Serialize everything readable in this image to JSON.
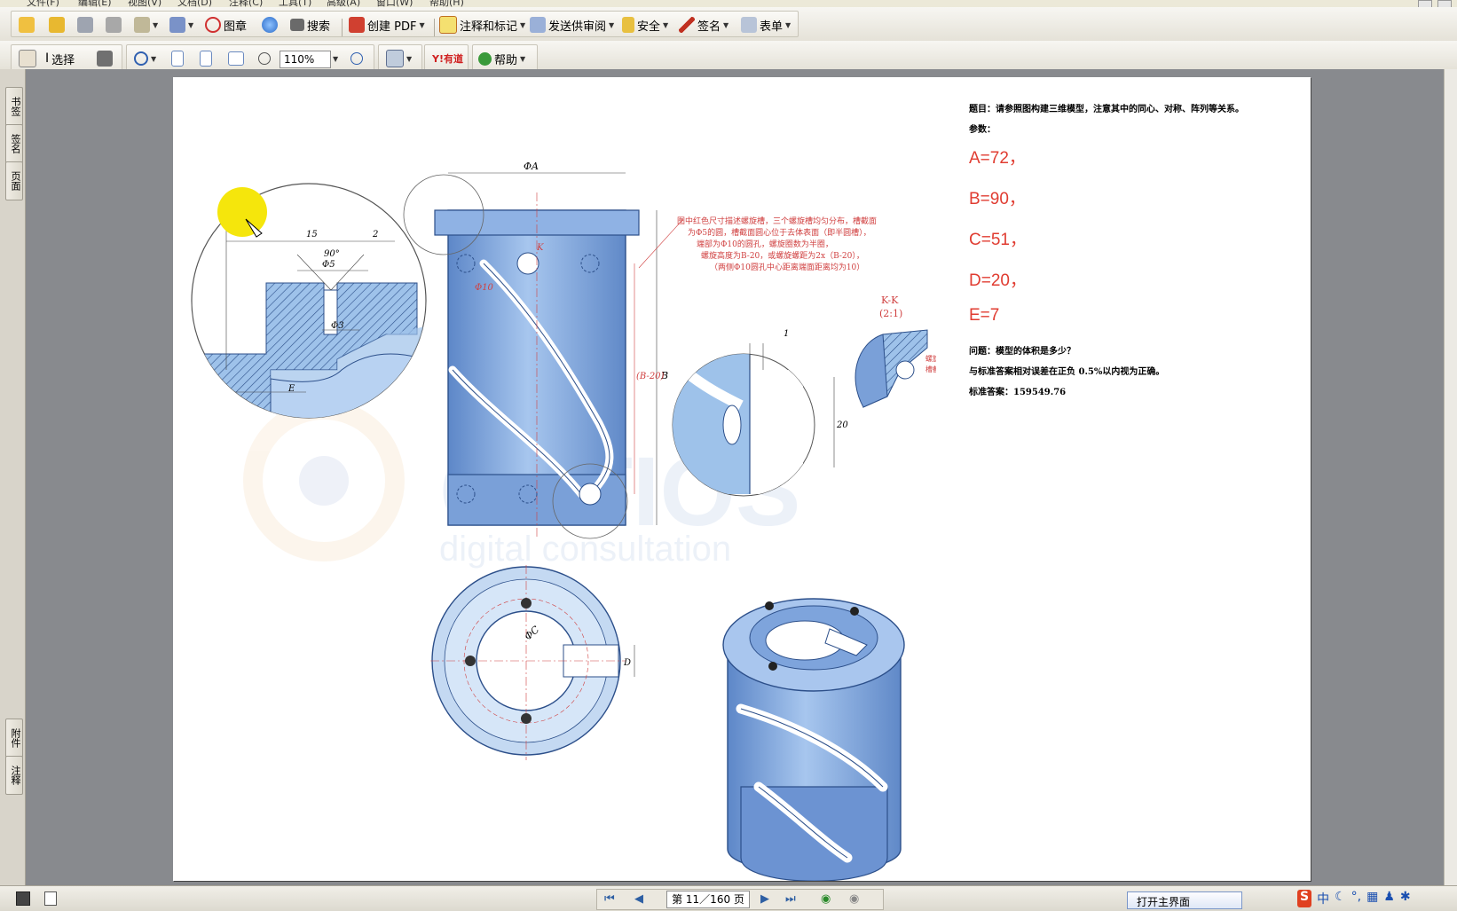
{
  "menubar": {
    "items": [
      "文件(F)",
      "编辑(E)",
      "视图(V)",
      "文档(D)",
      "注释(C)",
      "工具(T)",
      "高级(A)",
      "窗口(W)",
      "帮助(H)"
    ]
  },
  "toolbar1": {
    "stamp_label": "图章",
    "search_label": "搜索",
    "create_pdf_label": "创建 PDF",
    "comment_label": "注释和标记",
    "send_review_label": "发送供审阅",
    "security_label": "安全",
    "sign_label": "签名",
    "forms_label": "表单"
  },
  "toolbar2": {
    "select_label": "选择",
    "zoom_value": "110%",
    "help_label": "帮助",
    "yd_label": "Y!有道"
  },
  "left_tabs": {
    "bookmarks": "书签",
    "signatures": "签名",
    "pages": "页面",
    "attachments": "附件",
    "comments": "注释"
  },
  "page": {
    "question_title": "题目：请参照图构建三维模型，注意其中的同心、对称、阵列等关系。",
    "params_label": "参数：",
    "params": [
      "A=72，",
      "B=90，",
      "C=51，",
      "D=20，",
      "E=7"
    ],
    "question": "问题：模型的体积是多少？",
    "tolerance_note": "与标准答案相对误差在正负 0.5%以内视为正确。",
    "answer": "标准答案：159549.76",
    "drawing_note": [
      "图中红色尺寸描述螺旋槽，三个螺旋槽均匀分布，槽截面",
      "为Φ5的圆，槽截面圆心位于去体表面（即半圆槽），",
      "端部为Φ10的圆孔，螺旋圈数为半圈，",
      "螺旋高度为B-20，或螺旋螺距为2x（B-20），",
      "（两侧Φ10圆孔中心距离端面距离均为10）"
    ],
    "section_label": "K-K",
    "section_scale": "(2:1)",
    "section_note": "螺旋槽\n槽截面",
    "dims": {
      "phiA": "ΦA",
      "d15": "15",
      "d2": "2",
      "angle": "90°",
      "phi5": "Φ5",
      "phi3": "Φ3",
      "dE": "E",
      "d1": "1",
      "d20": "20",
      "dB": "B",
      "dB20": "(B-20)",
      "phiC": "ΦC",
      "dD": "D",
      "dK": "K",
      "phi10": "Φ10"
    },
    "watermark": "CATIOS",
    "watermark_sub": "digital consultation"
  },
  "statusbar": {
    "page_indicator": "第 11／160 页",
    "task_button": "打开主界面",
    "ime": "中"
  }
}
